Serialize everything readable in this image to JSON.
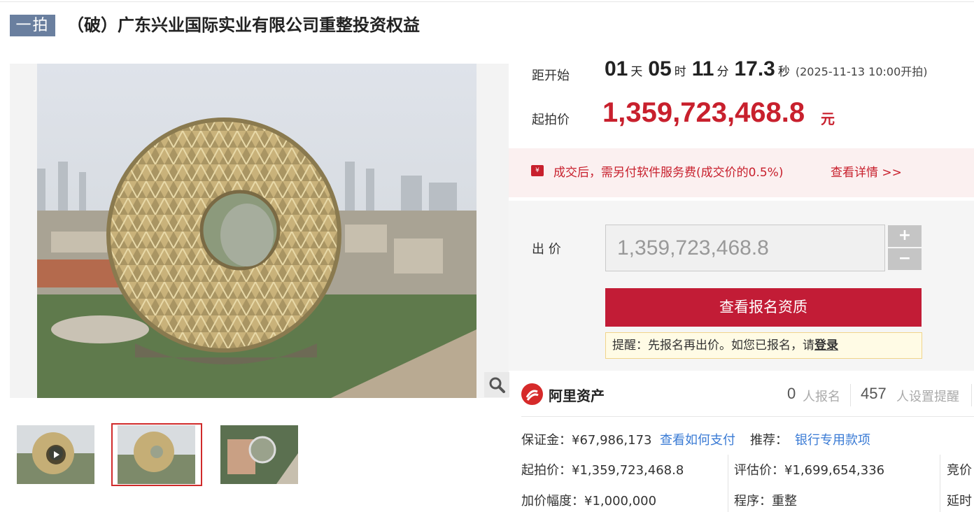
{
  "title": {
    "badge": "一拍",
    "text": "（破）广东兴业国际实业有限公司重整投资权益"
  },
  "countdown": {
    "label": "距开始",
    "days": "01",
    "days_unit": "天",
    "hours": "05",
    "hours_unit": "时",
    "minutes": "11",
    "minutes_unit": "分",
    "seconds": "17.3",
    "seconds_unit": "秒",
    "start_note": "(2025-11-13 10:00开拍)"
  },
  "start_price": {
    "label": "起拍价",
    "value": "1,359,723,468.8",
    "unit": "元"
  },
  "fee_notice": {
    "icon": "fee-badge-icon",
    "text": "成交后，需另付软件服务费(成交价的0.5%)",
    "link": "查看详情 >>"
  },
  "bid": {
    "label": "出 价",
    "input_value": "1,359,723,468.8",
    "plus": "+",
    "minus": "−",
    "cta": "查看报名资质",
    "reminder_prefix": "提醒：先报名再出价。如您已报名，请",
    "reminder_link": "登录"
  },
  "platform": {
    "name": "阿里资产",
    "registered_count": "0",
    "registered_label": "人报名",
    "reminder_count": "457",
    "reminder_label": "人设置提醒"
  },
  "details": {
    "deposit_label": "保证金：",
    "deposit_value": "¥67,986,173",
    "deposit_link": "查看如何支付",
    "recommend_label": "推荐：",
    "recommend_link": "银行专用款项",
    "start_price_label": "起拍价：",
    "start_price_value": "¥1,359,723,468.8",
    "appraisal_label": "评估价：",
    "appraisal_value": "¥1,699,654,336",
    "competition_label": "竞价",
    "increment_label": "加价幅度：",
    "increment_value": "¥1,000,000",
    "procedure_label": "程序：",
    "procedure_value": "重整",
    "delay_label": "延时"
  },
  "colors": {
    "accent_red": "#c8202d",
    "cta_red": "#c21c36",
    "badge_blue": "#6a7f9f",
    "link_blue": "#3a7bd5"
  }
}
